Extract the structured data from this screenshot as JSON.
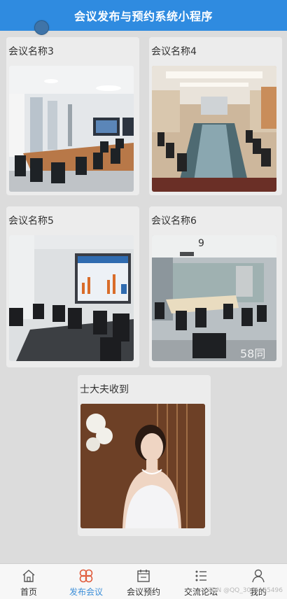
{
  "header": {
    "title": "会议发布与预约系统小程序"
  },
  "cards": [
    {
      "title": "会议名称3",
      "image": "meeting-room-screens-photo"
    },
    {
      "title": "会议名称4",
      "image": "boardroom-long-table-photo"
    },
    {
      "title": "会议名称5",
      "image": "meeting-room-presentation-screen-photo"
    },
    {
      "title": "会议名称6",
      "image": "conference-room-grey-photo"
    },
    {
      "title": "士大夫收到",
      "image": "woman-portrait-photo"
    }
  ],
  "tabbar": {
    "items": [
      {
        "label": "首页",
        "icon": "home-icon"
      },
      {
        "label": "发布会议",
        "icon": "grid-icon",
        "active": true
      },
      {
        "label": "会议预约",
        "icon": "calendar-icon"
      },
      {
        "label": "交流论坛",
        "icon": "list-icon"
      },
      {
        "label": "我的",
        "icon": "user-icon"
      }
    ]
  },
  "watermark": "CSDN @QQ_3066165496",
  "image_overlay_text": {
    "card4_logo": "58同",
    "card4_handwritten": "9"
  },
  "colors": {
    "header": "#2f8be0",
    "active_tab": "#3d8fd8",
    "background": "#dcdcdc"
  }
}
